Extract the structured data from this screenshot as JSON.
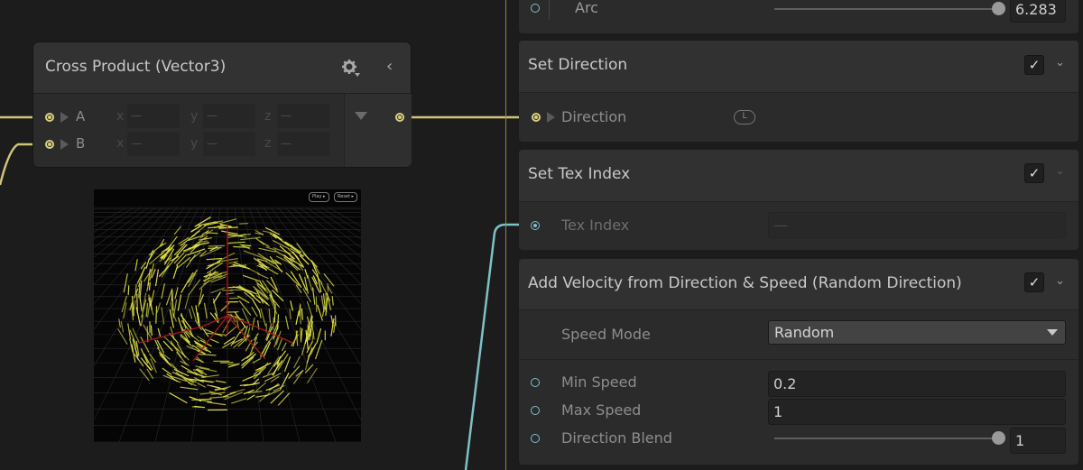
{
  "node": {
    "title": "Cross Product (Vector3)",
    "icons": {
      "settings": "gear-icon",
      "collapse": "chevron-left-icon"
    },
    "inputs": [
      {
        "label": "A",
        "axes": [
          "x",
          "y",
          "z"
        ],
        "values": [
          "—",
          "—",
          "—"
        ]
      },
      {
        "label": "B",
        "axes": [
          "x",
          "y",
          "z"
        ],
        "values": [
          "—",
          "—",
          "—"
        ]
      }
    ]
  },
  "preview": {
    "chips": [
      "Play ▸",
      "Reset ▸"
    ]
  },
  "inspector": {
    "arc": {
      "label": "Arc",
      "value": "6.283"
    },
    "set_direction": {
      "title": "Set Direction",
      "checked": true,
      "field_label": "Direction",
      "badge": "L"
    },
    "set_tex_index": {
      "title": "Set Tex Index",
      "checked": true,
      "field_label": "Tex Index",
      "value": "—"
    },
    "add_velocity": {
      "title": "Add Velocity from Direction & Speed (Random Direction)",
      "checked": true,
      "speed_mode_label": "Speed Mode",
      "speed_mode_value": "Random",
      "min_speed_label": "Min Speed",
      "min_speed_value": "0.2",
      "max_speed_label": "Max Speed",
      "max_speed_value": "1",
      "direction_blend_label": "Direction Blend",
      "direction_blend_value": "1"
    },
    "checkmark_glyph": "✓",
    "chevron_glyph": "⌄"
  },
  "colors": {
    "vector3_port": "#d9cf7c",
    "float_port": "#7ec1c6",
    "background": "#1c1c1c"
  }
}
